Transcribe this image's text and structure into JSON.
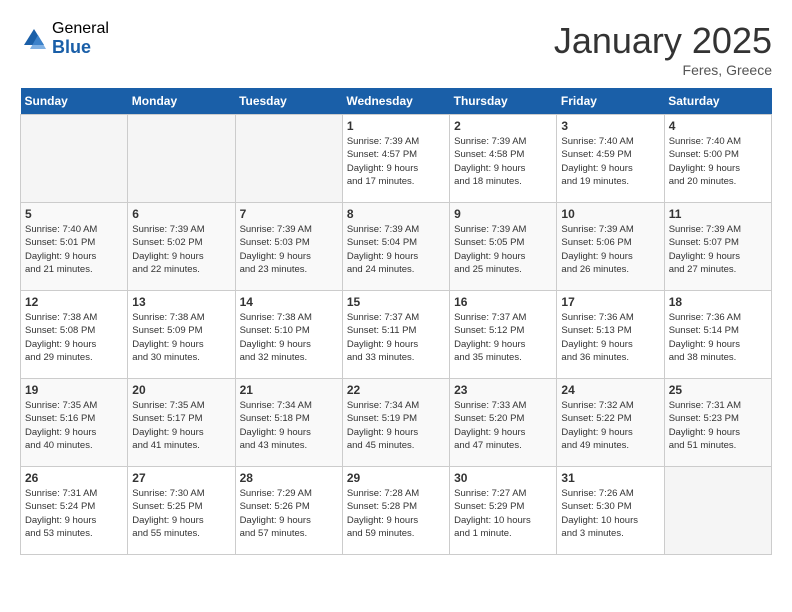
{
  "header": {
    "logo_general": "General",
    "logo_blue": "Blue",
    "title": "January 2025",
    "subtitle": "Feres, Greece"
  },
  "weekdays": [
    "Sunday",
    "Monday",
    "Tuesday",
    "Wednesday",
    "Thursday",
    "Friday",
    "Saturday"
  ],
  "weeks": [
    [
      {
        "day": "",
        "info": ""
      },
      {
        "day": "",
        "info": ""
      },
      {
        "day": "",
        "info": ""
      },
      {
        "day": "1",
        "info": "Sunrise: 7:39 AM\nSunset: 4:57 PM\nDaylight: 9 hours\nand 17 minutes."
      },
      {
        "day": "2",
        "info": "Sunrise: 7:39 AM\nSunset: 4:58 PM\nDaylight: 9 hours\nand 18 minutes."
      },
      {
        "day": "3",
        "info": "Sunrise: 7:40 AM\nSunset: 4:59 PM\nDaylight: 9 hours\nand 19 minutes."
      },
      {
        "day": "4",
        "info": "Sunrise: 7:40 AM\nSunset: 5:00 PM\nDaylight: 9 hours\nand 20 minutes."
      }
    ],
    [
      {
        "day": "5",
        "info": "Sunrise: 7:40 AM\nSunset: 5:01 PM\nDaylight: 9 hours\nand 21 minutes."
      },
      {
        "day": "6",
        "info": "Sunrise: 7:39 AM\nSunset: 5:02 PM\nDaylight: 9 hours\nand 22 minutes."
      },
      {
        "day": "7",
        "info": "Sunrise: 7:39 AM\nSunset: 5:03 PM\nDaylight: 9 hours\nand 23 minutes."
      },
      {
        "day": "8",
        "info": "Sunrise: 7:39 AM\nSunset: 5:04 PM\nDaylight: 9 hours\nand 24 minutes."
      },
      {
        "day": "9",
        "info": "Sunrise: 7:39 AM\nSunset: 5:05 PM\nDaylight: 9 hours\nand 25 minutes."
      },
      {
        "day": "10",
        "info": "Sunrise: 7:39 AM\nSunset: 5:06 PM\nDaylight: 9 hours\nand 26 minutes."
      },
      {
        "day": "11",
        "info": "Sunrise: 7:39 AM\nSunset: 5:07 PM\nDaylight: 9 hours\nand 27 minutes."
      }
    ],
    [
      {
        "day": "12",
        "info": "Sunrise: 7:38 AM\nSunset: 5:08 PM\nDaylight: 9 hours\nand 29 minutes."
      },
      {
        "day": "13",
        "info": "Sunrise: 7:38 AM\nSunset: 5:09 PM\nDaylight: 9 hours\nand 30 minutes."
      },
      {
        "day": "14",
        "info": "Sunrise: 7:38 AM\nSunset: 5:10 PM\nDaylight: 9 hours\nand 32 minutes."
      },
      {
        "day": "15",
        "info": "Sunrise: 7:37 AM\nSunset: 5:11 PM\nDaylight: 9 hours\nand 33 minutes."
      },
      {
        "day": "16",
        "info": "Sunrise: 7:37 AM\nSunset: 5:12 PM\nDaylight: 9 hours\nand 35 minutes."
      },
      {
        "day": "17",
        "info": "Sunrise: 7:36 AM\nSunset: 5:13 PM\nDaylight: 9 hours\nand 36 minutes."
      },
      {
        "day": "18",
        "info": "Sunrise: 7:36 AM\nSunset: 5:14 PM\nDaylight: 9 hours\nand 38 minutes."
      }
    ],
    [
      {
        "day": "19",
        "info": "Sunrise: 7:35 AM\nSunset: 5:16 PM\nDaylight: 9 hours\nand 40 minutes."
      },
      {
        "day": "20",
        "info": "Sunrise: 7:35 AM\nSunset: 5:17 PM\nDaylight: 9 hours\nand 41 minutes."
      },
      {
        "day": "21",
        "info": "Sunrise: 7:34 AM\nSunset: 5:18 PM\nDaylight: 9 hours\nand 43 minutes."
      },
      {
        "day": "22",
        "info": "Sunrise: 7:34 AM\nSunset: 5:19 PM\nDaylight: 9 hours\nand 45 minutes."
      },
      {
        "day": "23",
        "info": "Sunrise: 7:33 AM\nSunset: 5:20 PM\nDaylight: 9 hours\nand 47 minutes."
      },
      {
        "day": "24",
        "info": "Sunrise: 7:32 AM\nSunset: 5:22 PM\nDaylight: 9 hours\nand 49 minutes."
      },
      {
        "day": "25",
        "info": "Sunrise: 7:31 AM\nSunset: 5:23 PM\nDaylight: 9 hours\nand 51 minutes."
      }
    ],
    [
      {
        "day": "26",
        "info": "Sunrise: 7:31 AM\nSunset: 5:24 PM\nDaylight: 9 hours\nand 53 minutes."
      },
      {
        "day": "27",
        "info": "Sunrise: 7:30 AM\nSunset: 5:25 PM\nDaylight: 9 hours\nand 55 minutes."
      },
      {
        "day": "28",
        "info": "Sunrise: 7:29 AM\nSunset: 5:26 PM\nDaylight: 9 hours\nand 57 minutes."
      },
      {
        "day": "29",
        "info": "Sunrise: 7:28 AM\nSunset: 5:28 PM\nDaylight: 9 hours\nand 59 minutes."
      },
      {
        "day": "30",
        "info": "Sunrise: 7:27 AM\nSunset: 5:29 PM\nDaylight: 10 hours\nand 1 minute."
      },
      {
        "day": "31",
        "info": "Sunrise: 7:26 AM\nSunset: 5:30 PM\nDaylight: 10 hours\nand 3 minutes."
      },
      {
        "day": "",
        "info": ""
      }
    ]
  ]
}
